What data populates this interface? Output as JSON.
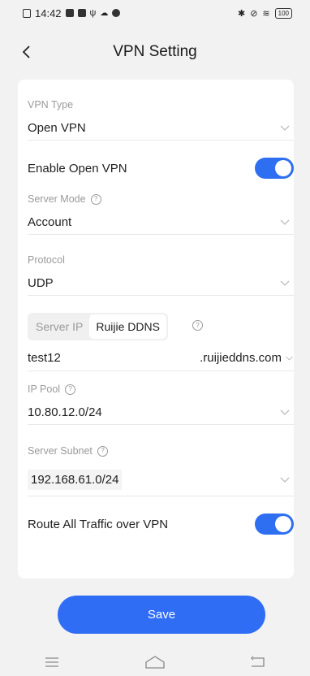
{
  "status_bar": {
    "time": "14:42",
    "battery": "100"
  },
  "header": {
    "title": "VPN Setting"
  },
  "form": {
    "vpn_type": {
      "label": "VPN Type",
      "value": "Open VPN"
    },
    "enable_vpn": {
      "label": "Enable Open VPN",
      "on": true
    },
    "server_mode": {
      "label": "Server Mode",
      "value": "Account"
    },
    "protocol": {
      "label": "Protocol",
      "value": "UDP"
    },
    "address_tabs": [
      "Server IP",
      "Ruijie DDNS"
    ],
    "active_tab": "Ruijie DDNS",
    "ddns": {
      "value": "test12",
      "suffix": ".ruijieddns.com"
    },
    "ip_pool": {
      "label": "IP Pool",
      "value": "10.80.12.0/24"
    },
    "server_subnet": {
      "label": "Server Subnet",
      "value": "192.168.61.0/24"
    },
    "route_all": {
      "label": "Route All Traffic over VPN",
      "on": true
    }
  },
  "actions": {
    "save_label": "Save"
  },
  "colors": {
    "accent": "#2f6df5",
    "toggle_on": "#2e6ff2",
    "label_gray": "#9a9a9a"
  }
}
